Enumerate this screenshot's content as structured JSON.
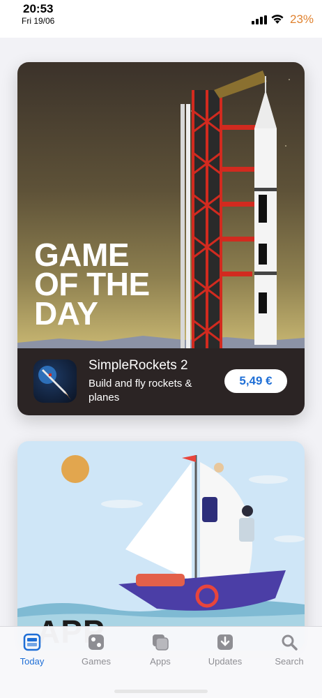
{
  "status_bar": {
    "time": "20:53",
    "date": "Fri 19/06",
    "battery": "23%"
  },
  "game_card": {
    "headline": [
      "GAME",
      "OF THE",
      "DAY"
    ],
    "app_name": "SimpleRockets 2",
    "app_subtitle": "Build and fly rockets & planes",
    "price": "5,49 €",
    "icon": "rocket-app-icon"
  },
  "app_card": {
    "peek_title": "APP"
  },
  "tab_bar": {
    "tabs": [
      {
        "label": "Today",
        "icon": "today-icon",
        "active": true
      },
      {
        "label": "Games",
        "icon": "games-icon",
        "active": false
      },
      {
        "label": "Apps",
        "icon": "apps-icon",
        "active": false
      },
      {
        "label": "Updates",
        "icon": "updates-icon",
        "active": false
      },
      {
        "label": "Search",
        "icon": "search-icon",
        "active": false
      }
    ]
  },
  "colors": {
    "accent": "#1f6fd6",
    "battery": "#e0822f",
    "tab_inactive": "#8e8e93"
  }
}
